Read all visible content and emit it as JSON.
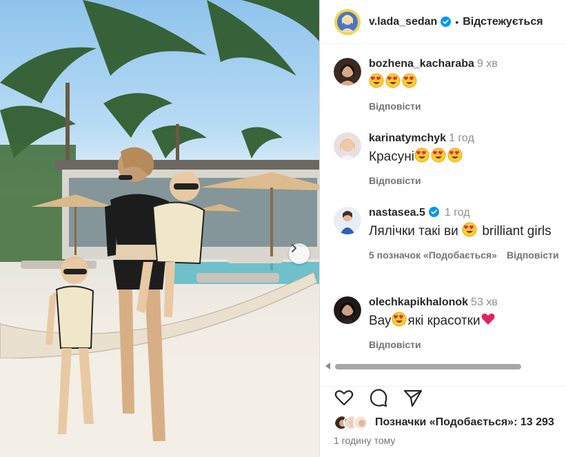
{
  "post": {
    "photo_alt": "",
    "next_icon": "chevron-right-icon"
  },
  "header": {
    "username": "v.lada_sedan",
    "separator": "•",
    "follow_label": "Відстежується",
    "verified_color": "#0095f6"
  },
  "comments": [
    {
      "user": "bozhena_kacharaba",
      "time": "9 хв",
      "text": "",
      "emoji_count": 3,
      "actions": [
        "Відповісти"
      ]
    },
    {
      "user": "karinatymchyk",
      "time": "1 год",
      "text": "Красуні",
      "emoji_count": 3,
      "actions": [
        "Відповісти"
      ]
    },
    {
      "user": "nastasea.5",
      "verified": true,
      "time": "1 год",
      "text_before": "Лялічки такі ви",
      "text_after": "brilliant girls",
      "emoji_count": 1,
      "actions": [
        "5 позначок «Подобається»",
        "Відповісти"
      ]
    },
    {
      "user": "olechkapikhalonok",
      "time": "53 хв",
      "text_before": "Вау",
      "text_after": "які красотки",
      "emoji_count": 1,
      "actions": [
        "Відповісти"
      ]
    }
  ],
  "footer": {
    "likes_text": "Позначки «Подобається»: 13 293",
    "time_ago": "1 годину тому"
  },
  "colors": {
    "text": "#262626",
    "secondary": "#737373",
    "accent": "#0095f6",
    "heart": "#e0245e"
  }
}
